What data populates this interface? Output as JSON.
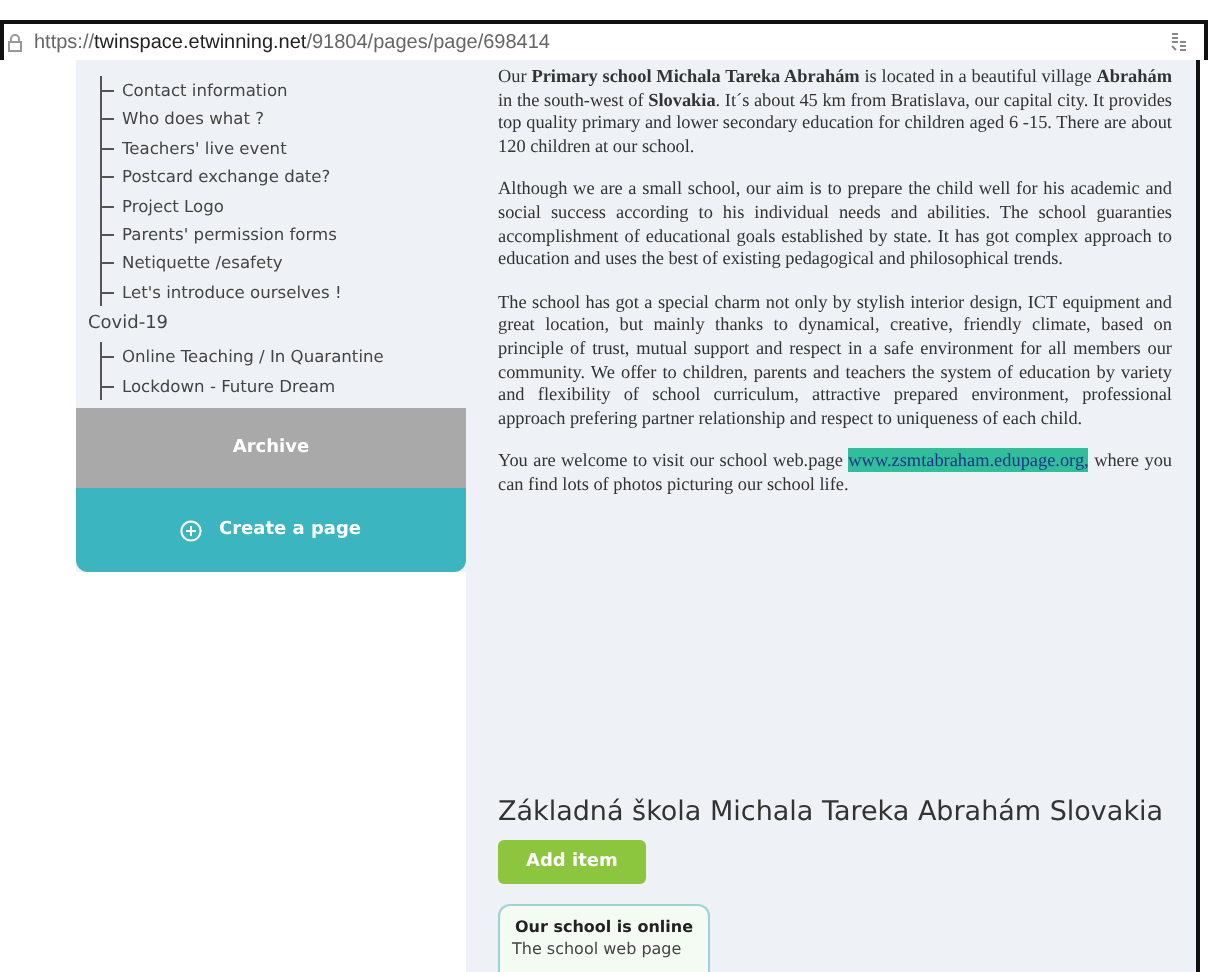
{
  "address_bar": {
    "url_prefix": "https://",
    "url_domain": "twinspace.etwinning.net",
    "url_path": "/91804/pages/page/698414"
  },
  "sidebar": {
    "groups": [
      {
        "children": [
          {
            "label": "Contact information"
          },
          {
            "label": "Who does what ?"
          },
          {
            "label": "Teachers' live event"
          },
          {
            "label": "Postcard exchange date?"
          },
          {
            "label": "Project Logo"
          },
          {
            "label": "Parents' permission forms"
          },
          {
            "label": "Netiquette /esafety"
          },
          {
            "label": "Let's introduce ourselves !"
          }
        ]
      },
      {
        "title": "Covid-19",
        "children": [
          {
            "label": "Online Teaching / In Quarantine"
          },
          {
            "label": "Lockdown - Future Dream"
          }
        ]
      }
    ],
    "archive_button": "Archive",
    "create_button": "Create a page"
  },
  "article": {
    "paragraphs": [
      {
        "text": "Our **Primary school Michala Tareka Abrahám** is located in a beautiful village **Abrahám** in the south-west of **Slovakia**. It´s about 45 km from Bratislava, our capital city. It provides top quality primary and lower secondary education for children aged 6 -15. There are about 120 children at our school."
      },
      {
        "text": "Although we are a small school, our aim is to prepare the child well for his academic and social success according to his individual needs and abilities. The school guaranties accomplishment of educational goals established by state. It has got complex approach to education and uses the best of existing pedagogical and philosophical trends."
      },
      {
        "text": "The school has got a special charm not only by stylish interior design, ICT equipment and great location, but mainly thanks to dynamical, creative, friendly climate, based on principle of trust, mutual support and respect in a safe environment for all members our community. We offer to children, parents and teachers the system of education by variety and flexibility of school curriculum, attractive prepared environment, professional approach prefering partner relationship and respect to uniqueness of each child."
      },
      {
        "text": "You are welcome to visit our school web.page",
        "link": "www.zsmtabraham.edupage.org,",
        "after": "where you can find lots of photos picturing our school life."
      }
    ]
  },
  "section": {
    "title": "Základná škola Michala Tareka Abrahám Slovakia",
    "add_button": "Add item",
    "cards": [
      {
        "title": "Our school is online",
        "text": "The school web page"
      }
    ]
  }
}
